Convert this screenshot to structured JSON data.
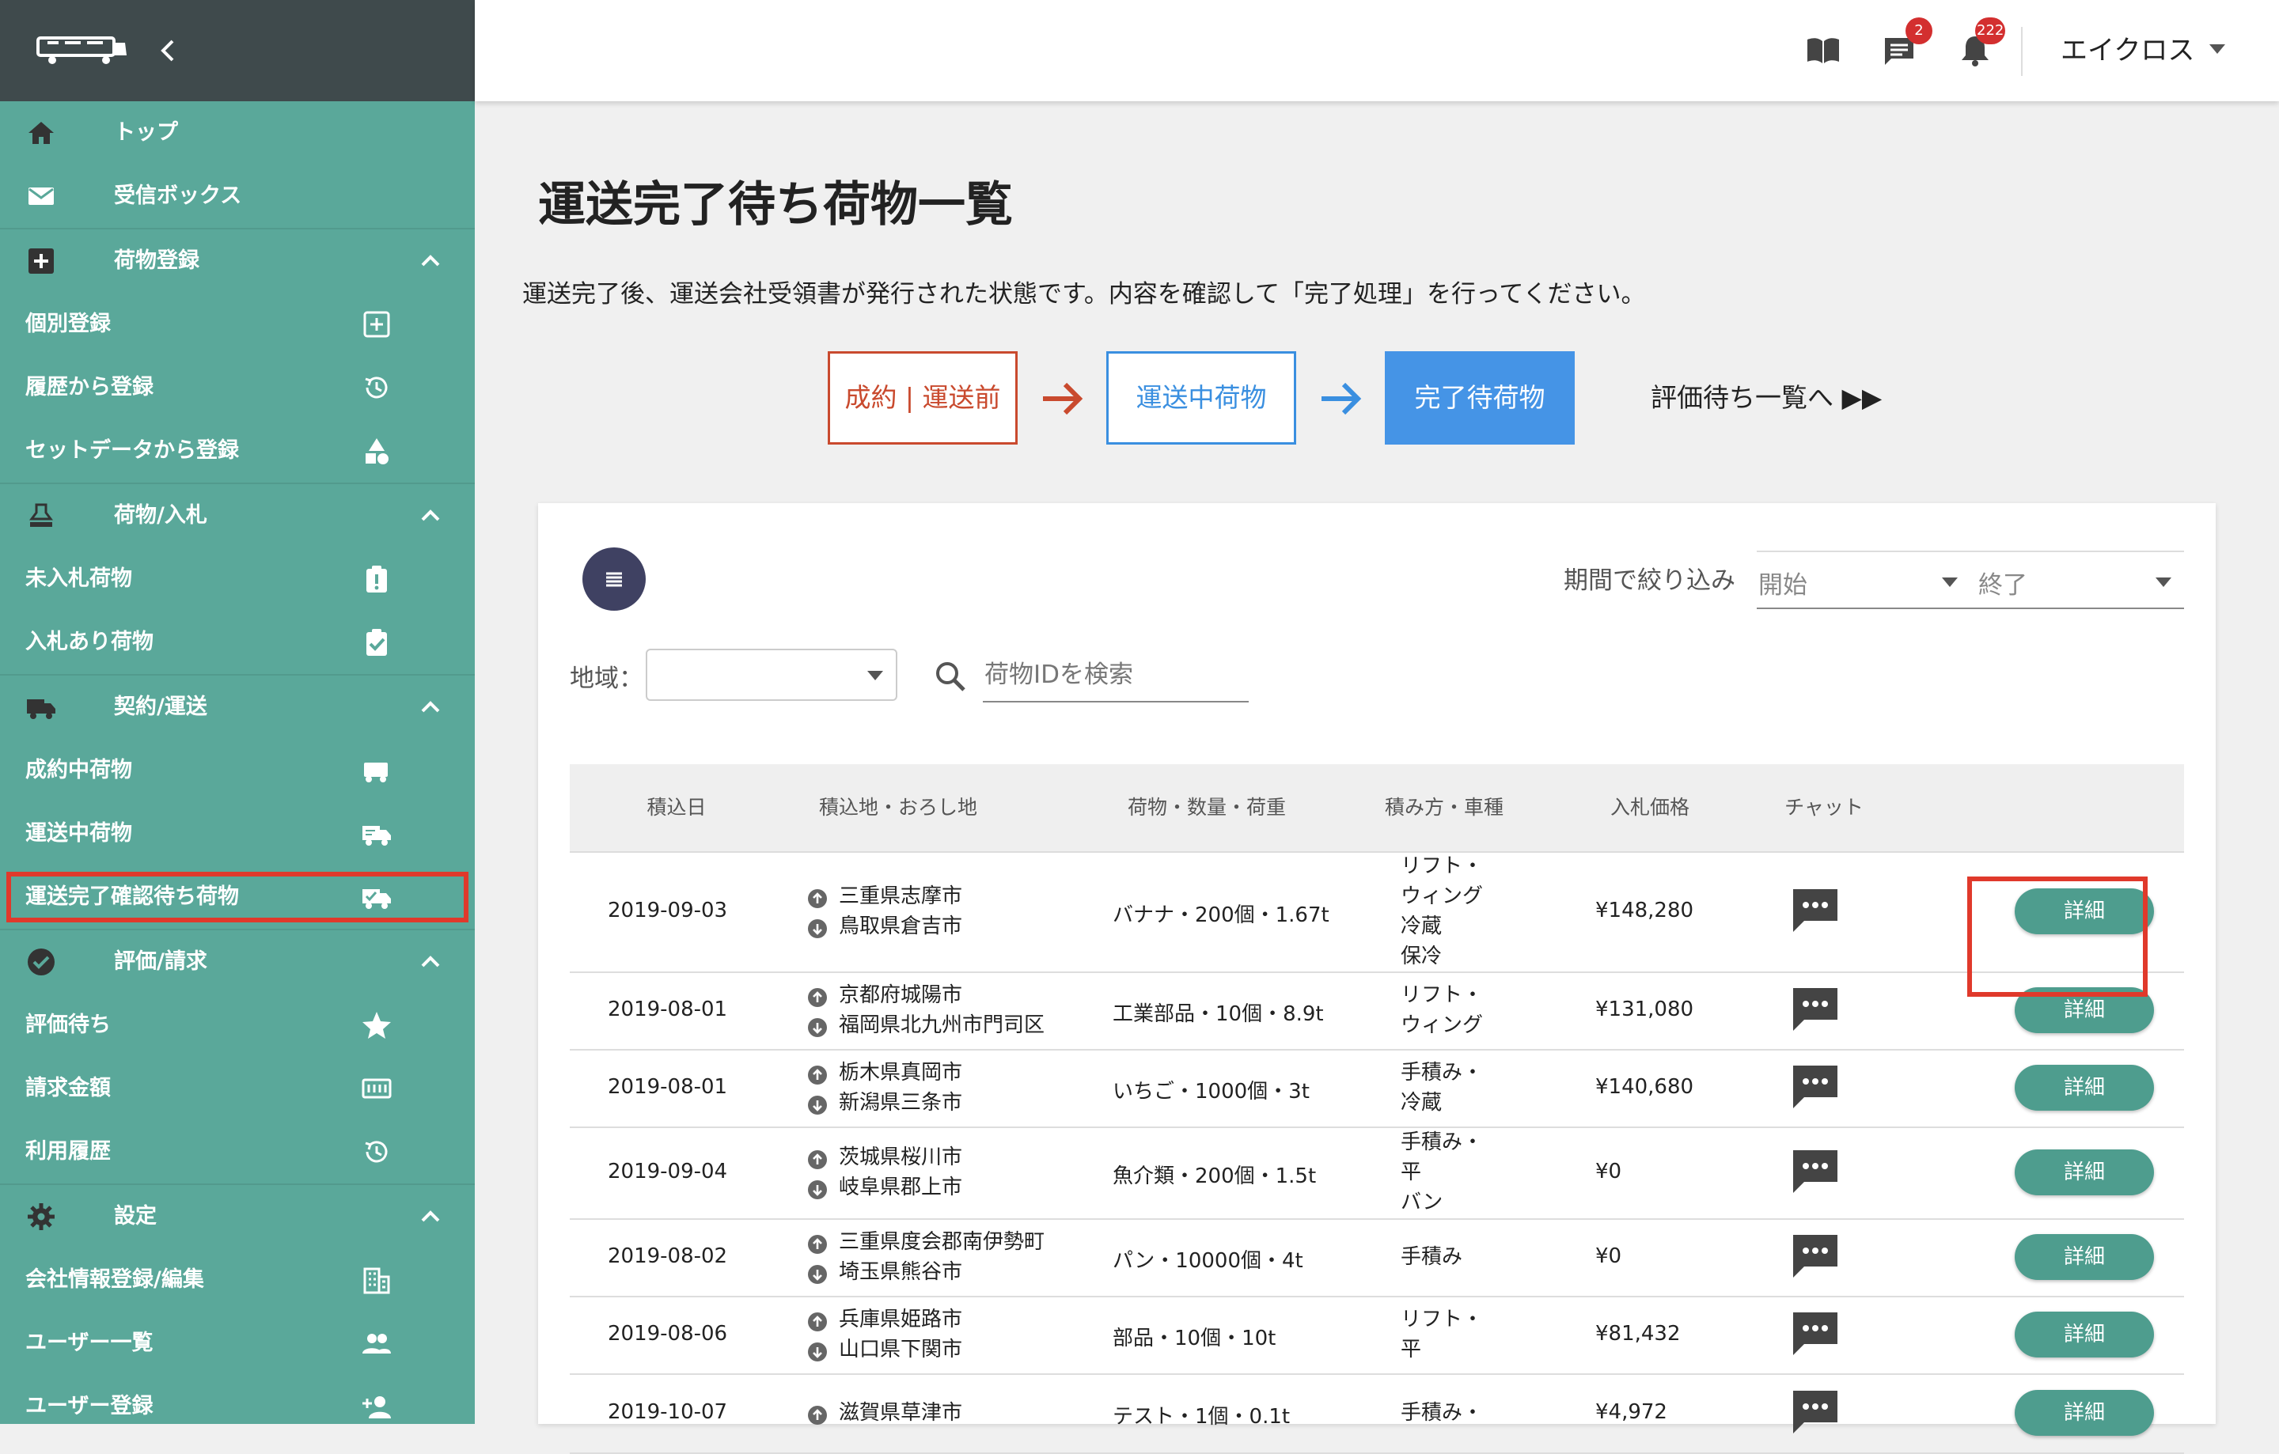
{
  "sidebar": {
    "menu": {
      "top": "トップ",
      "inbox": "受信ボックス",
      "cargo_registration": "荷物登録",
      "individual_registration": "個別登録",
      "register_from_history": "履歴から登録",
      "register_from_set_data": "セットデータから登録",
      "cargo_bid": "荷物/入札",
      "no_bid_cargo": "未入札荷物",
      "bid_cargo": "入札あり荷物",
      "contract_transport": "契約/運送",
      "contracted_cargo": "成約中荷物",
      "in_transit_cargo": "運送中荷物",
      "awaiting_completion_cargo": "運送完了確認待ち荷物",
      "evaluation_billing": "評価/請求",
      "awaiting_evaluation": "評価待ち",
      "billing_amount": "請求金額",
      "usage_history": "利用履歴",
      "settings": "設定",
      "company_info": "会社情報登録/編集",
      "user_list": "ユーザー一覧",
      "user_registration": "ユーザー登録"
    }
  },
  "header": {
    "chat_badge": "2",
    "notification_badge": "222",
    "user_name": "エイクロス"
  },
  "main": {
    "title": "運送完了待ち荷物一覧",
    "description": "運送完了後、運送会社受領書が発行された状態です。内容を確認して「完了処理」を行ってください。",
    "steps": [
      "成約 | 運送前",
      "運送中荷物",
      "完了待荷物"
    ],
    "eval_link": "評価待ち一覧へ ▶▶"
  },
  "filters": {
    "period_label": "期間で絞り込み",
    "start_placeholder": "開始",
    "end_placeholder": "終了",
    "region_label": "地域：",
    "search_placeholder": "荷物IDを検索"
  },
  "table": {
    "headers": [
      "積込日",
      "積込地・おろし地",
      "荷物・数量・荷重",
      "積み方・車種",
      "入札価格",
      "チャット"
    ],
    "detail_label": "詳細",
    "rows": [
      {
        "date": "2019-09-03",
        "from": "三重県志摩市",
        "to": "鳥取県倉吉市",
        "cargo": "バナナ・200個・1.67t",
        "loading": [
          "リフト・",
          "ウィング",
          "冷蔵",
          "保冷"
        ],
        "price": "¥148,280"
      },
      {
        "date": "2019-08-01",
        "from": "京都府城陽市",
        "to": "福岡県北九州市門司区",
        "cargo": "工業部品・10個・8.9t",
        "loading": [
          "リフト・",
          "ウィング"
        ],
        "price": "¥131,080"
      },
      {
        "date": "2019-08-01",
        "from": "栃木県真岡市",
        "to": "新潟県三条市",
        "cargo": "いちご・1000個・3t",
        "loading": [
          "手積み・",
          "冷蔵"
        ],
        "price": "¥140,680"
      },
      {
        "date": "2019-09-04",
        "from": "茨城県桜川市",
        "to": "岐阜県郡上市",
        "cargo": "魚介類・200個・1.5t",
        "loading": [
          "手積み・",
          "平",
          "バン"
        ],
        "price": "¥0"
      },
      {
        "date": "2019-08-02",
        "from": "三重県度会郡南伊勢町",
        "to": "埼玉県熊谷市",
        "cargo": "パン・10000個・4t",
        "loading": [
          "手積み"
        ],
        "price": "¥0"
      },
      {
        "date": "2019-08-06",
        "from": "兵庫県姫路市",
        "to": "山口県下関市",
        "cargo": "部品・10個・10t",
        "loading": [
          "リフト・",
          "平"
        ],
        "price": "¥81,432"
      },
      {
        "date": "2019-10-07",
        "from": "滋賀県草津市",
        "to": "",
        "cargo": "テスト・1個・0.1t",
        "loading": [
          "手積み・"
        ],
        "price": "¥4,972"
      }
    ]
  }
}
